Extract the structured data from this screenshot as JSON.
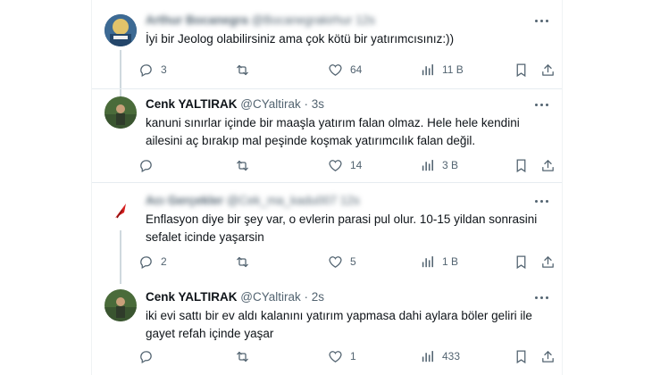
{
  "tweets": [
    {
      "name": "Arthur Bocanegra",
      "handle": "@Bocanegrakirhur",
      "time": "12s",
      "text": "İyi bir Jeolog olabilirsiniz ama çok kötü bir yatırımcısınız:))",
      "replies": "3",
      "retweets": "",
      "likes": "64",
      "views": "11 B"
    },
    {
      "name": "Cenk YALTIRAK",
      "handle": "@CYaltirak",
      "dot": "·",
      "time": "3s",
      "text": "kanuni sınırlar içinde bir maaşla yatırım falan olmaz.  Hele hele kendini ailesini aç bırakıp mal peşinde koşmak yatırımcılık falan değil.",
      "replies": "",
      "retweets": "",
      "likes": "14",
      "views": "3 B"
    },
    {
      "name": "Acı Gerçekler",
      "handle": "@Cek_ma_kadu007",
      "time": "12s",
      "text": "Enflasyon diye bir şey var, o evlerin parasi pul olur. 10-15 yildan sonrasini sefalet icinde yaşarsin",
      "replies": "2",
      "retweets": "",
      "likes": "5",
      "views": "1 B"
    },
    {
      "name": "Cenk YALTIRAK",
      "handle": "@CYaltirak",
      "dot": "·",
      "time": "2s",
      "text": "iki evi sattı bir ev aldı kalanını yatırım yapmasa dahi aylara böler geliri ile gayet refah içinde yaşar",
      "replies": "",
      "retweets": "",
      "likes": "1",
      "views": "433"
    }
  ],
  "colors": {
    "text_primary": "#0f1419",
    "text_secondary": "#536471",
    "divider": "#e6ecf0",
    "thread_line": "#cfd9de"
  },
  "icons": [
    "reply-icon",
    "retweet-icon",
    "like-icon",
    "views-icon",
    "bookmark-icon",
    "share-icon",
    "more-icon"
  ]
}
